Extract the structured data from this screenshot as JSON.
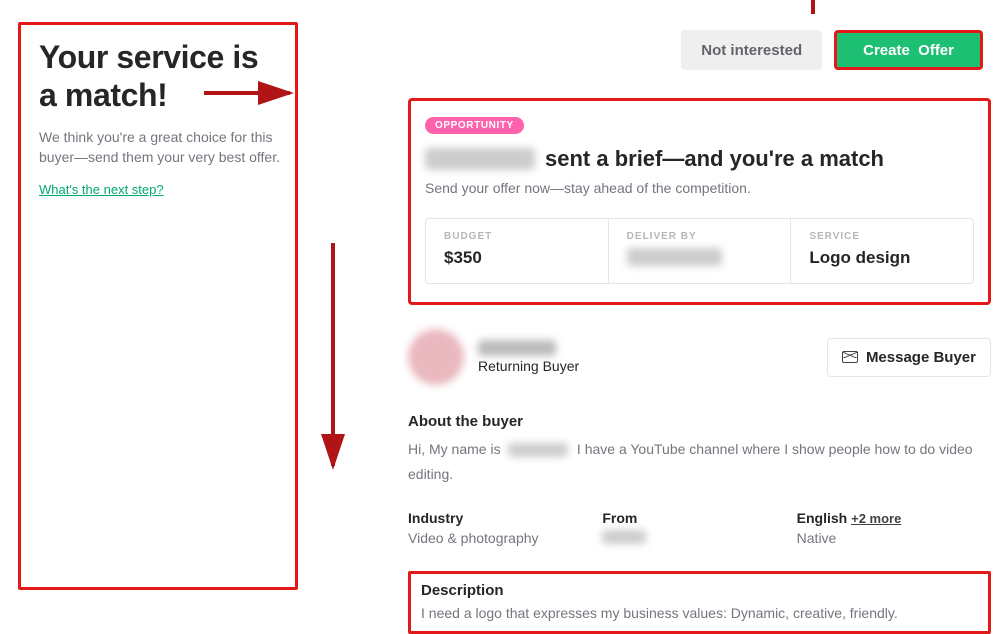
{
  "left": {
    "title": "Your service is a match!",
    "subtitle": "We think you're a great choice for this buyer—send them your very best offer.",
    "link": "What's the next step?"
  },
  "actions": {
    "not_interested": "Not interested",
    "create_offer": "Create  Offer"
  },
  "card": {
    "badge": "OPPORTUNITY",
    "headline_suffix": " sent a brief—and you're a match",
    "subtitle": "Send your offer now—stay ahead of the competition.",
    "budget_label": "BUDGET",
    "budget_value": "$350",
    "deliver_label": "DELIVER BY",
    "service_label": "SERVICE",
    "service_value": "Logo design"
  },
  "buyer": {
    "returning": "Returning Buyer",
    "message_button": "Message Buyer",
    "about_title": "About the buyer",
    "bio_prefix": "Hi, My name is ",
    "bio_suffix": " I have a YouTube channel where I show people how to do video editing.",
    "industry_label": "Industry",
    "industry_value": "Video & photography",
    "from_label": "From",
    "english_label": "English",
    "english_more": "+2 more",
    "english_value": "Native"
  },
  "description": {
    "label": "Description",
    "text": "I need a logo that expresses my business values: Dynamic, creative, friendly."
  },
  "colors": {
    "highlight": "#e31919",
    "primary": "#1dbf73",
    "pink": "#ff62ad"
  }
}
